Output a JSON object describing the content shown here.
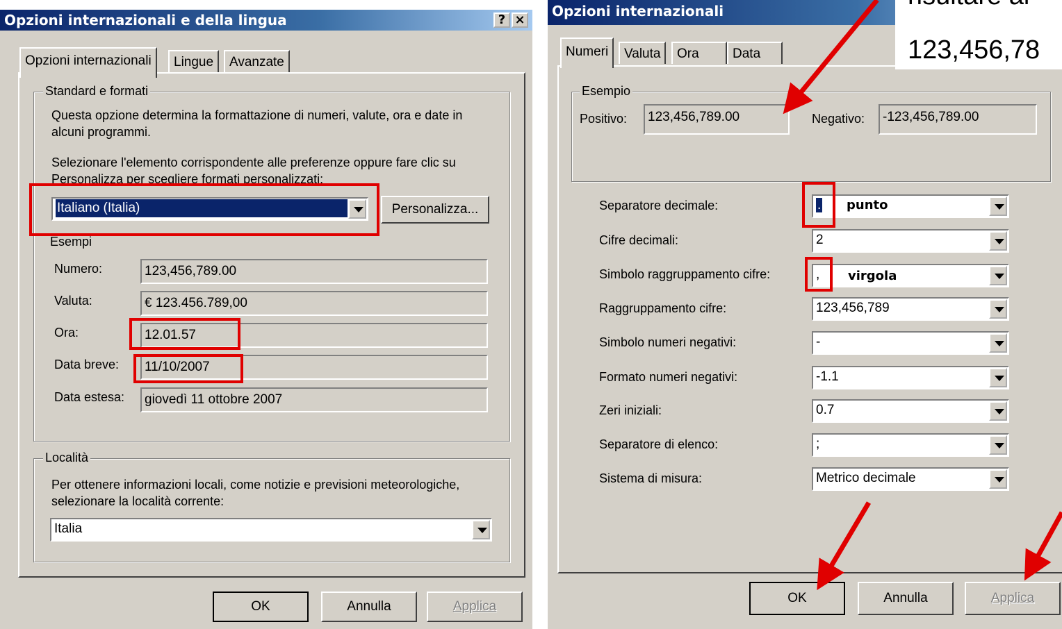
{
  "left_dialog": {
    "title": "Opzioni internazionali e della lingua",
    "help_btn": "?",
    "close_btn": "×",
    "tabs": [
      "Opzioni internazionali",
      "Lingue",
      "Avanzate"
    ],
    "standard_group": {
      "legend": "Standard e formati",
      "desc_line1": "Questa opzione determina la formattazione di numeri, valute, ora e date in",
      "desc_line2": "alcuni programmi.",
      "select_line1": "Selezionare l'elemento corrispondente alle preferenze oppure fare clic su",
      "select_line2": "Personalizza per scegliere formati personalizzati:",
      "locale_value": "Italiano (Italia)",
      "customize_button": "Personalizza...",
      "examples_label": "Esempi",
      "examples": [
        {
          "label": "Numero:",
          "value": "123,456,789.00"
        },
        {
          "label": "Valuta:",
          "value": "€ 123.456.789,00"
        },
        {
          "label": "Ora:",
          "value": "12.01.57"
        },
        {
          "label": "Data breve:",
          "value": "11/10/2007"
        },
        {
          "label": "Data estesa:",
          "value": "giovedì 11 ottobre 2007"
        }
      ]
    },
    "location_group": {
      "legend": "Località",
      "desc_line1": "Per ottenere informazioni locali, come notizie e previsioni meteorologiche,",
      "desc_line2": "selezionare la località corrente:",
      "value": "Italia"
    },
    "buttons": {
      "ok": "OK",
      "cancel": "Annulla",
      "apply": "Applica"
    }
  },
  "right_dialog": {
    "title": "Opzioni internazionali",
    "tabs": [
      "Numeri",
      "Valuta",
      "Ora",
      "Data"
    ],
    "example_group": {
      "legend": "Esempio",
      "positive_label": "Positivo:",
      "positive_value": "123,456,789.00",
      "negative_label": "Negativo:",
      "negative_value": "-123,456,789.00"
    },
    "settings": [
      {
        "label": "Separatore decimale:",
        "value": "."
      },
      {
        "label": "Cifre decimali:",
        "value": "2"
      },
      {
        "label": "Simbolo raggruppamento cifre:",
        "value": ","
      },
      {
        "label": "Raggruppamento cifre:",
        "value": "123,456,789"
      },
      {
        "label": "Simbolo numeri negativi:",
        "value": "-"
      },
      {
        "label": "Formato numeri negativi:",
        "value": "-1.1"
      },
      {
        "label": "Zeri iniziali:",
        "value": "0.7"
      },
      {
        "label": "Separatore di elenco:",
        "value": ";"
      },
      {
        "label": "Sistema di misura:",
        "value": "Metrico decimale"
      }
    ],
    "annotations": {
      "decimal": "punto",
      "grouping": "virgola"
    },
    "buttons": {
      "ok": "OK",
      "cancel": "Annulla",
      "apply": "Applica"
    }
  },
  "overlay_note": {
    "line1": "risultare al",
    "line2": "123,456,78"
  },
  "colors": {
    "highlight": "#e00000",
    "dialog": "#d4d0c8",
    "titlebar": "#0a246a"
  }
}
